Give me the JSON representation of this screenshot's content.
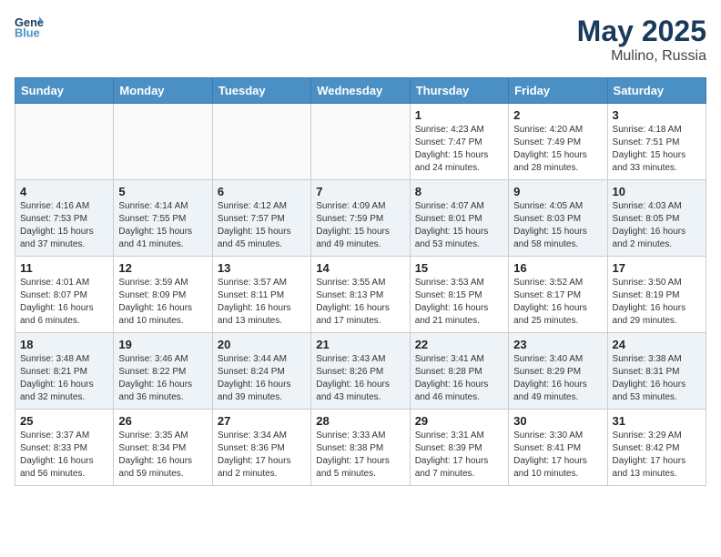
{
  "header": {
    "logo_line1": "General",
    "logo_line2": "Blue",
    "month": "May 2025",
    "location": "Mulino, Russia"
  },
  "weekdays": [
    "Sunday",
    "Monday",
    "Tuesday",
    "Wednesday",
    "Thursday",
    "Friday",
    "Saturday"
  ],
  "weeks": [
    {
      "row_class": "row-even",
      "days": [
        {
          "num": "",
          "info": "",
          "empty": true
        },
        {
          "num": "",
          "info": "",
          "empty": true
        },
        {
          "num": "",
          "info": "",
          "empty": true
        },
        {
          "num": "",
          "info": "",
          "empty": true
        },
        {
          "num": "1",
          "info": "Sunrise: 4:23 AM\nSunset: 7:47 PM\nDaylight: 15 hours\nand 24 minutes.",
          "empty": false
        },
        {
          "num": "2",
          "info": "Sunrise: 4:20 AM\nSunset: 7:49 PM\nDaylight: 15 hours\nand 28 minutes.",
          "empty": false
        },
        {
          "num": "3",
          "info": "Sunrise: 4:18 AM\nSunset: 7:51 PM\nDaylight: 15 hours\nand 33 minutes.",
          "empty": false
        }
      ]
    },
    {
      "row_class": "row-odd",
      "days": [
        {
          "num": "4",
          "info": "Sunrise: 4:16 AM\nSunset: 7:53 PM\nDaylight: 15 hours\nand 37 minutes.",
          "empty": false
        },
        {
          "num": "5",
          "info": "Sunrise: 4:14 AM\nSunset: 7:55 PM\nDaylight: 15 hours\nand 41 minutes.",
          "empty": false
        },
        {
          "num": "6",
          "info": "Sunrise: 4:12 AM\nSunset: 7:57 PM\nDaylight: 15 hours\nand 45 minutes.",
          "empty": false
        },
        {
          "num": "7",
          "info": "Sunrise: 4:09 AM\nSunset: 7:59 PM\nDaylight: 15 hours\nand 49 minutes.",
          "empty": false
        },
        {
          "num": "8",
          "info": "Sunrise: 4:07 AM\nSunset: 8:01 PM\nDaylight: 15 hours\nand 53 minutes.",
          "empty": false
        },
        {
          "num": "9",
          "info": "Sunrise: 4:05 AM\nSunset: 8:03 PM\nDaylight: 15 hours\nand 58 minutes.",
          "empty": false
        },
        {
          "num": "10",
          "info": "Sunrise: 4:03 AM\nSunset: 8:05 PM\nDaylight: 16 hours\nand 2 minutes.",
          "empty": false
        }
      ]
    },
    {
      "row_class": "row-even",
      "days": [
        {
          "num": "11",
          "info": "Sunrise: 4:01 AM\nSunset: 8:07 PM\nDaylight: 16 hours\nand 6 minutes.",
          "empty": false
        },
        {
          "num": "12",
          "info": "Sunrise: 3:59 AM\nSunset: 8:09 PM\nDaylight: 16 hours\nand 10 minutes.",
          "empty": false
        },
        {
          "num": "13",
          "info": "Sunrise: 3:57 AM\nSunset: 8:11 PM\nDaylight: 16 hours\nand 13 minutes.",
          "empty": false
        },
        {
          "num": "14",
          "info": "Sunrise: 3:55 AM\nSunset: 8:13 PM\nDaylight: 16 hours\nand 17 minutes.",
          "empty": false
        },
        {
          "num": "15",
          "info": "Sunrise: 3:53 AM\nSunset: 8:15 PM\nDaylight: 16 hours\nand 21 minutes.",
          "empty": false
        },
        {
          "num": "16",
          "info": "Sunrise: 3:52 AM\nSunset: 8:17 PM\nDaylight: 16 hours\nand 25 minutes.",
          "empty": false
        },
        {
          "num": "17",
          "info": "Sunrise: 3:50 AM\nSunset: 8:19 PM\nDaylight: 16 hours\nand 29 minutes.",
          "empty": false
        }
      ]
    },
    {
      "row_class": "row-odd",
      "days": [
        {
          "num": "18",
          "info": "Sunrise: 3:48 AM\nSunset: 8:21 PM\nDaylight: 16 hours\nand 32 minutes.",
          "empty": false
        },
        {
          "num": "19",
          "info": "Sunrise: 3:46 AM\nSunset: 8:22 PM\nDaylight: 16 hours\nand 36 minutes.",
          "empty": false
        },
        {
          "num": "20",
          "info": "Sunrise: 3:44 AM\nSunset: 8:24 PM\nDaylight: 16 hours\nand 39 minutes.",
          "empty": false
        },
        {
          "num": "21",
          "info": "Sunrise: 3:43 AM\nSunset: 8:26 PM\nDaylight: 16 hours\nand 43 minutes.",
          "empty": false
        },
        {
          "num": "22",
          "info": "Sunrise: 3:41 AM\nSunset: 8:28 PM\nDaylight: 16 hours\nand 46 minutes.",
          "empty": false
        },
        {
          "num": "23",
          "info": "Sunrise: 3:40 AM\nSunset: 8:29 PM\nDaylight: 16 hours\nand 49 minutes.",
          "empty": false
        },
        {
          "num": "24",
          "info": "Sunrise: 3:38 AM\nSunset: 8:31 PM\nDaylight: 16 hours\nand 53 minutes.",
          "empty": false
        }
      ]
    },
    {
      "row_class": "row-even",
      "days": [
        {
          "num": "25",
          "info": "Sunrise: 3:37 AM\nSunset: 8:33 PM\nDaylight: 16 hours\nand 56 minutes.",
          "empty": false
        },
        {
          "num": "26",
          "info": "Sunrise: 3:35 AM\nSunset: 8:34 PM\nDaylight: 16 hours\nand 59 minutes.",
          "empty": false
        },
        {
          "num": "27",
          "info": "Sunrise: 3:34 AM\nSunset: 8:36 PM\nDaylight: 17 hours\nand 2 minutes.",
          "empty": false
        },
        {
          "num": "28",
          "info": "Sunrise: 3:33 AM\nSunset: 8:38 PM\nDaylight: 17 hours\nand 5 minutes.",
          "empty": false
        },
        {
          "num": "29",
          "info": "Sunrise: 3:31 AM\nSunset: 8:39 PM\nDaylight: 17 hours\nand 7 minutes.",
          "empty": false
        },
        {
          "num": "30",
          "info": "Sunrise: 3:30 AM\nSunset: 8:41 PM\nDaylight: 17 hours\nand 10 minutes.",
          "empty": false
        },
        {
          "num": "31",
          "info": "Sunrise: 3:29 AM\nSunset: 8:42 PM\nDaylight: 17 hours\nand 13 minutes.",
          "empty": false
        }
      ]
    }
  ]
}
